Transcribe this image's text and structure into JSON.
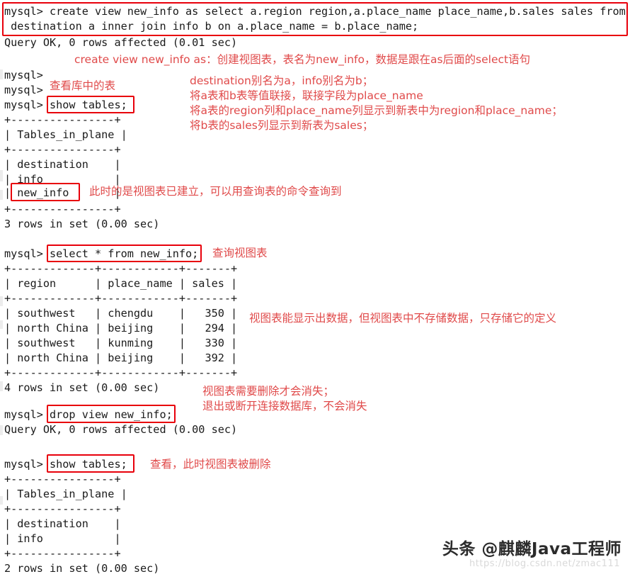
{
  "terminal": {
    "prompt": "mysql>",
    "lines": [
      "mysql> create view new_info as select a.region region,a.place_name place_name,b.sales sales from",
      " destination a inner join info b on a.place_name = b.place_name;",
      "Query OK, 0 rows affected (0.01 sec)",
      "",
      "mysql>",
      "mysql>",
      "mysql> show tables;",
      "+----------------+",
      "| Tables_in_plane |",
      "+----------------+",
      "| destination    |",
      "| info           |",
      "| new_info       |",
      "+----------------+",
      "3 rows in set (0.00 sec)",
      "",
      "mysql> select * from new_info;",
      "+-------------+------------+-------+",
      "| region      | place_name | sales |",
      "+-------------+------------+-------+",
      "| southwest   | chengdu    |   350 |",
      "| north China | beijing    |   294 |",
      "| southwest   | kunming    |   330 |",
      "| north China | beijing    |   392 |",
      "+-------------+------------+-------+",
      "4 rows in set (0.00 sec)",
      "",
      "mysql> drop view new_info;",
      "Query OK, 0 rows affected (0.00 sec)",
      "",
      "mysql> show tables;",
      "+----------------+",
      "| Tables_in_plane |",
      "+----------------+",
      "| destination    |",
      "| info           |",
      "+----------------+",
      "2 rows in set (0.00 sec)"
    ]
  },
  "commands": {
    "create_view": "create view new_info as select a.region region,a.place_name place_name,b.sales sales from destination a inner join info b on a.place_name = b.place_name;",
    "show_tables_1": "show tables;",
    "select_all": "select * from new_info;",
    "drop_view": "drop view new_info;",
    "show_tables_2": "show tables;",
    "highlighted_cell": "new_info"
  },
  "results": {
    "query_ok_1": "Query OK, 0 rows affected (0.01 sec)",
    "query_ok_2": "Query OK, 0 rows affected (0.00 sec)",
    "rows_3": "3 rows in set (0.00 sec)",
    "rows_4": "4 rows in set (0.00 sec)",
    "rows_2": "2 rows in set (0.00 sec)"
  },
  "tables": {
    "show_tables_before": {
      "header": "Tables_in_plane",
      "rows": [
        "destination",
        "info",
        "new_info"
      ],
      "count": "3 rows in set (0.00 sec)"
    },
    "view_contents": {
      "headers": [
        "region",
        "place_name",
        "sales"
      ],
      "rows": [
        [
          "southwest",
          "chengdu",
          "350"
        ],
        [
          "north China",
          "beijing",
          "294"
        ],
        [
          "southwest",
          "kunming",
          "330"
        ],
        [
          "north China",
          "beijing",
          "392"
        ]
      ],
      "count": "4 rows in set (0.00 sec)"
    },
    "show_tables_after": {
      "header": "Tables_in_plane",
      "rows": [
        "destination",
        "info"
      ],
      "count": "2 rows in set (0.00 sec)"
    }
  },
  "annotations": {
    "create_view_explain": "create view new_info as：创建视图表，表名为new_info，数据是跟在as后面的select语句",
    "show_tables_label": "查看库中的表",
    "join_explain_1": "destination别名为a，info别名为b；",
    "join_explain_2": "将a表和b表等值联接，联接字段为place_name",
    "join_explain_3": "将a表的region列和place_name列显示到新表中为region和place_name；",
    "join_explain_4": "将b表的sales列显示到新表为sales；",
    "view_created": "此时的是视图表已建立，可以用查询表的命令查询到",
    "select_label": "查询视图表",
    "view_no_storage": "视图表能显示出数据，但视图表中不存储数据，只存储它的定义",
    "drop_explain_1": "视图表需要删除才会消失；",
    "drop_explain_2": "退出或断开连接数据库，不会消失",
    "after_drop_label": "查看，此时视图表被删除"
  },
  "watermark": {
    "text": "头条 @麒麟Java工程师",
    "url": "https://blog.csdn.net/zmac111"
  },
  "colors": {
    "box_red": "#e8000b",
    "annotation_red": "#e04a4a",
    "terminal_text": "#1a1a1a",
    "background": "#ffffff"
  }
}
